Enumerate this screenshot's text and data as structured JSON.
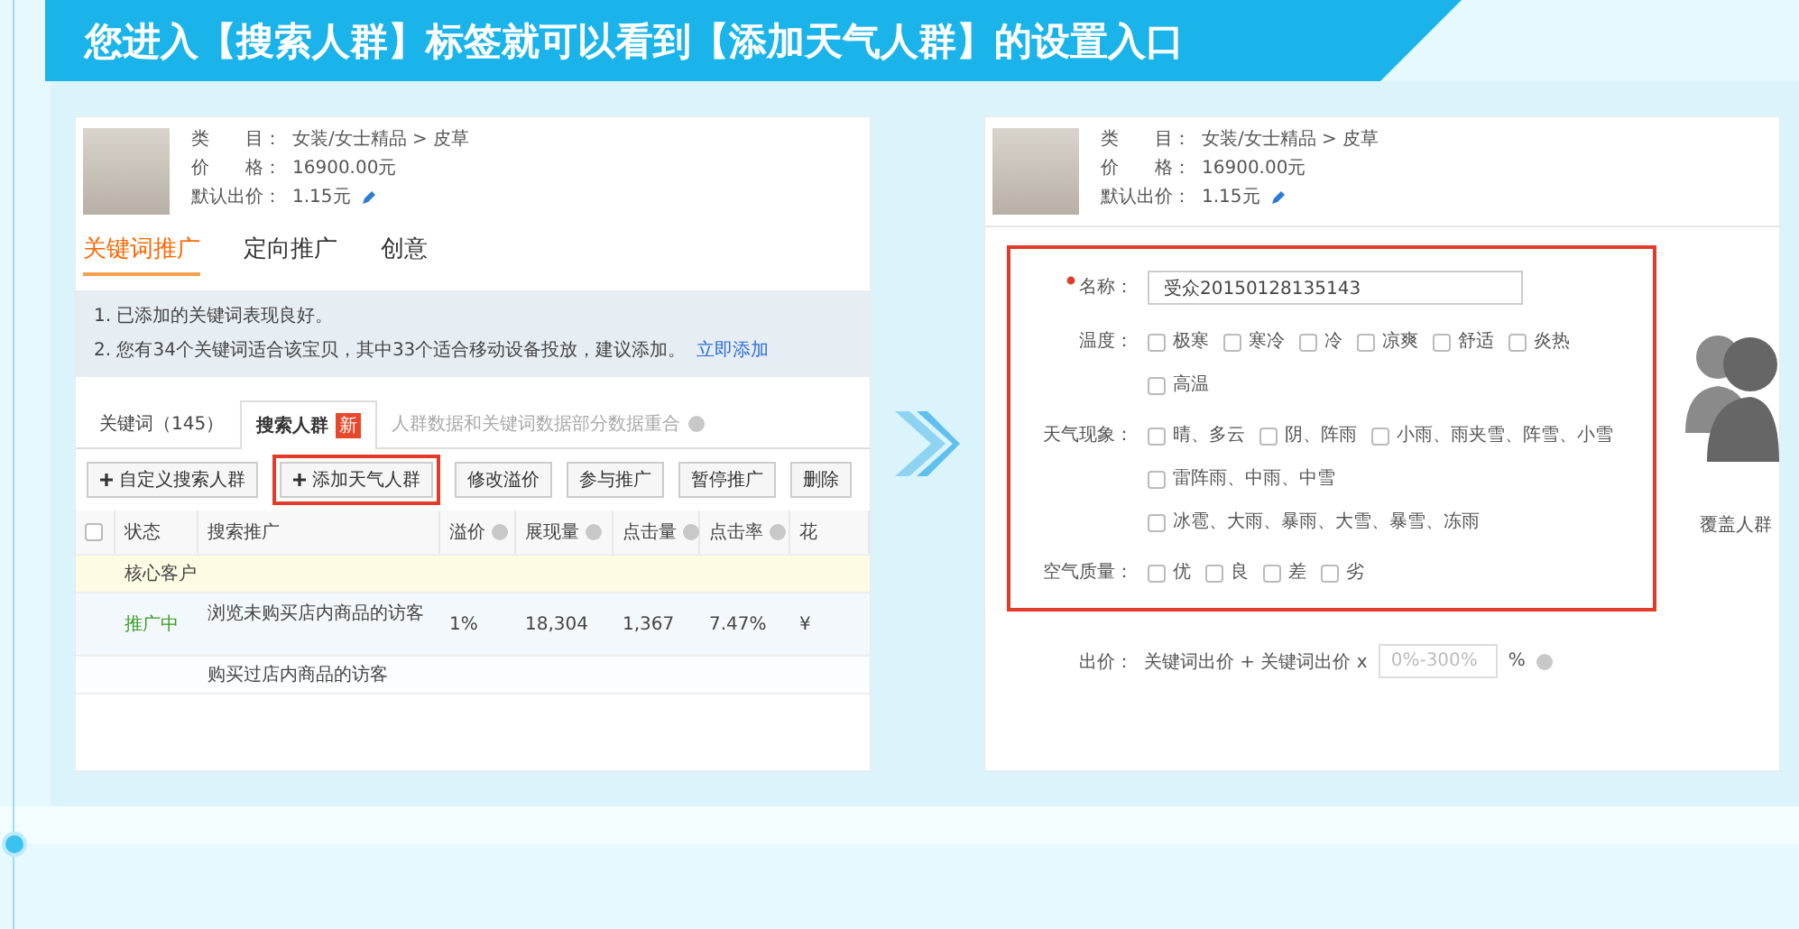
{
  "banner": {
    "title": "您进入【搜索人群】标签就可以看到【添加天气人群】的设置入口"
  },
  "left_screen": {
    "product": {
      "fields": [
        {
          "label": "类　　目：",
          "value": "女装/女士精品 > 皮草"
        },
        {
          "label": "价　　格：",
          "value": "16900.00元"
        },
        {
          "label": "默认出价：",
          "value": "1.15元",
          "editable": true
        }
      ]
    },
    "tabs": [
      {
        "label": "关键词推广",
        "selected": true
      },
      {
        "label": "定向推广",
        "selected": false
      },
      {
        "label": "创意",
        "selected": false
      }
    ],
    "notices": [
      {
        "text": "1. 已添加的关键词表现良好。"
      },
      {
        "text": "2. 您有34个关键词适合该宝贝，其中33个适合移动设备投放，建议添加。",
        "link": "立即添加"
      }
    ],
    "subtabs": [
      {
        "label": "关键词（145）",
        "selected": false
      },
      {
        "label": "搜索人群",
        "badge": "新",
        "selected": true
      }
    ],
    "subtab_note": "人群数据和关键词数据部分数据重合",
    "toolbar": [
      {
        "label": "自定义搜索人群",
        "plus": true,
        "highlighted": false
      },
      {
        "label": "添加天气人群",
        "plus": true,
        "highlighted": true
      },
      {
        "label": "修改溢价",
        "plus": false,
        "highlighted": false
      },
      {
        "label": "参与推广",
        "plus": false,
        "highlighted": false
      },
      {
        "label": "暂停推广",
        "plus": false,
        "highlighted": false
      },
      {
        "label": "删除",
        "plus": false,
        "highlighted": false
      }
    ],
    "table": {
      "select_all": {
        "checked": false
      },
      "columns": [
        {
          "label": "状态",
          "help": false
        },
        {
          "label": "搜索推广",
          "help": false
        },
        {
          "label": "溢价",
          "help": true
        },
        {
          "label": "展现量",
          "help": true
        },
        {
          "label": "点击量",
          "help": true
        },
        {
          "label": "点击率",
          "help": true
        },
        {
          "label": "花",
          "help": false
        }
      ],
      "rows": [
        {
          "kind": "group",
          "label": "核心客户"
        },
        {
          "kind": "data",
          "active": true,
          "cells": [
            "推广中",
            "浏览未购买店内商品的访客",
            "1%",
            "18,304",
            "1,367",
            "7.47%",
            "¥"
          ]
        },
        {
          "kind": "cut",
          "label": "购买过店内商品的访客"
        }
      ]
    }
  },
  "right_screen": {
    "product": {
      "fields": [
        {
          "label": "类　　目：",
          "value": "女装/女士精品 > 皮草"
        },
        {
          "label": "价　　格：",
          "value": "16900.00元"
        },
        {
          "label": "默认出价：",
          "value": "1.15元",
          "editable": true
        }
      ]
    },
    "form": {
      "highlighted": true,
      "name_field": {
        "label": "名称：",
        "required": true,
        "value": "受众20150128135143"
      },
      "groups": [
        {
          "label": "温度：",
          "options": [
            {
              "label": "极寒",
              "checked": false
            },
            {
              "label": "寒冷",
              "checked": false
            },
            {
              "label": "冷",
              "checked": false
            },
            {
              "label": "凉爽",
              "checked": false
            },
            {
              "label": "舒适",
              "checked": false
            },
            {
              "label": "炎热",
              "checked": false
            },
            {
              "label": "高温",
              "checked": false
            }
          ]
        },
        {
          "label": "天气现象：",
          "options": [
            {
              "label": "晴、多云",
              "checked": false
            },
            {
              "label": "阴、阵雨",
              "checked": false
            },
            {
              "label": "小雨、雨夹雪、阵雪、小雪",
              "checked": false
            },
            {
              "label": "雷阵雨、中雨、中雪",
              "checked": false
            },
            {
              "label": "冰雹、大雨、暴雨、大雪、暴雪、冻雨",
              "checked": false
            }
          ]
        },
        {
          "label": "空气质量：",
          "options": [
            {
              "label": "优",
              "checked": false
            },
            {
              "label": "良",
              "checked": false
            },
            {
              "label": "差",
              "checked": false
            },
            {
              "label": "劣",
              "checked": false
            }
          ]
        }
      ]
    },
    "coverage": {
      "label": "覆盖人群"
    },
    "bid": {
      "label": "出价：",
      "formula": "关键词出价 + 关键词出价 x",
      "placeholder": "0%-300%",
      "unit": "%"
    }
  }
}
